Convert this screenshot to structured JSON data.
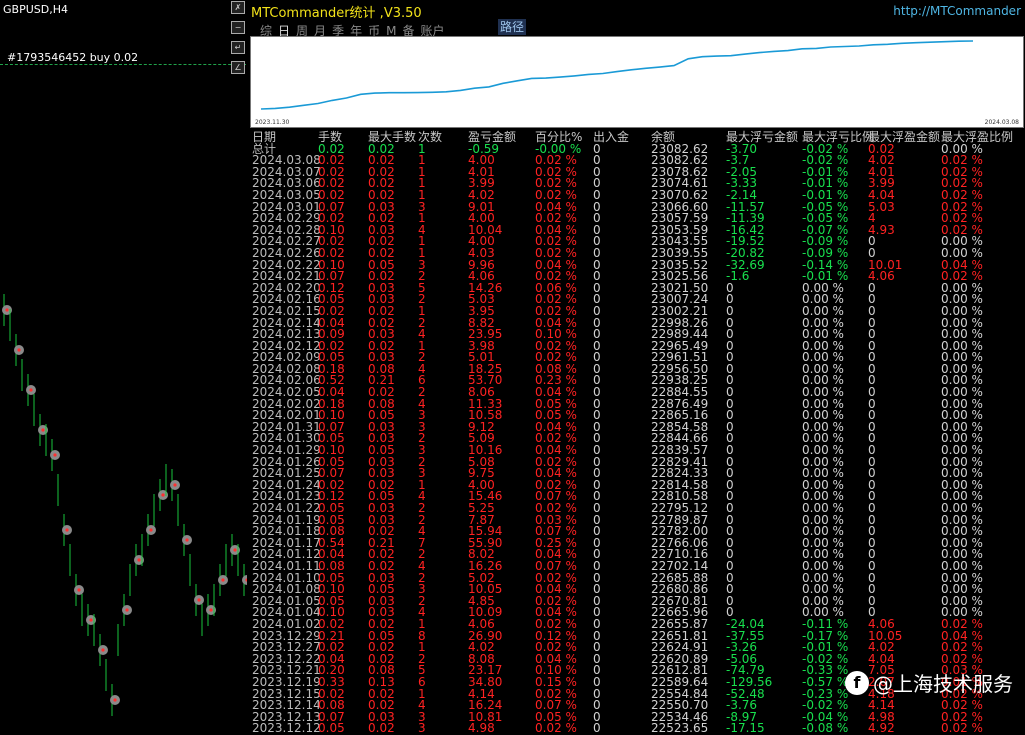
{
  "chart": {
    "title": "GBPUSD,H4",
    "order_label": "#1793546452 buy 0.02",
    "buttons": [
      "✗",
      "−",
      "↵",
      "∠"
    ]
  },
  "panel": {
    "title": "MTCommander统计 ,V3.50",
    "url": "http://MTCommander",
    "tabs": [
      "综",
      "日",
      "周",
      "月",
      "季",
      "年",
      "币",
      "M",
      "备",
      "账户"
    ],
    "active_tab_index": 1,
    "route_button": "路径",
    "equity": {
      "start_label": "2023.11.30",
      "end_label": "2024.03.08",
      "line_color": "#1a9ad6",
      "values": [
        22530,
        22535,
        22545,
        22560,
        22575,
        22600,
        22620,
        22650,
        22660,
        22663,
        22663,
        22664,
        22666,
        22670,
        22682,
        22700,
        22710,
        22740,
        22760,
        22780,
        22782,
        22790,
        22800,
        22812,
        22820,
        22835,
        22850,
        22862,
        22872,
        22884,
        22940,
        22957,
        22962,
        22965,
        22978,
        22990,
        23000,
        23007,
        23021,
        23025,
        23036,
        23040,
        23044,
        23054,
        23058,
        23066,
        23071,
        23075,
        23079,
        23083,
        23085
      ]
    }
  },
  "table": {
    "headers": [
      "日期",
      "手数",
      "最大手数",
      "次数",
      "盈亏金额",
      "百分比%",
      "出入金",
      "余额",
      "最大浮亏金额",
      "最大浮亏比例",
      "最大浮盈金额",
      "最大浮盈比例"
    ],
    "rows": [
      [
        "总计",
        "0.02",
        "0.02",
        "1",
        "-0.59",
        "-0.00 %",
        "0",
        "23082.62",
        "-3.70",
        "-0.02 %",
        "0.02",
        "0.00 %"
      ],
      [
        "2024.03.08",
        "0.02",
        "0.02",
        "1",
        "4.00",
        "0.02 %",
        "0",
        "23082.62",
        "-3.7",
        "-0.02 %",
        "4.02",
        "0.02 %"
      ],
      [
        "2024.03.07",
        "0.02",
        "0.02",
        "1",
        "4.01",
        "0.02 %",
        "0",
        "23078.62",
        "-2.05",
        "-0.01 %",
        "4.01",
        "0.02 %"
      ],
      [
        "2024.03.06",
        "0.02",
        "0.02",
        "1",
        "3.99",
        "0.02 %",
        "0",
        "23074.61",
        "-3.33",
        "-0.01 %",
        "3.99",
        "0.02 %"
      ],
      [
        "2024.03.05",
        "0.02",
        "0.02",
        "1",
        "4.02",
        "0.02 %",
        "0",
        "23070.62",
        "-2.14",
        "-0.01 %",
        "4.04",
        "0.02 %"
      ],
      [
        "2024.03.01",
        "0.07",
        "0.03",
        "3",
        "9.01",
        "0.04 %",
        "0",
        "23066.60",
        "-11.57",
        "-0.05 %",
        "5.03",
        "0.02 %"
      ],
      [
        "2024.02.29",
        "0.02",
        "0.02",
        "1",
        "4.00",
        "0.02 %",
        "0",
        "23057.59",
        "-11.39",
        "-0.05 %",
        "4",
        "0.02 %"
      ],
      [
        "2024.02.28",
        "0.10",
        "0.03",
        "4",
        "10.04",
        "0.04 %",
        "0",
        "23053.59",
        "-16.42",
        "-0.07 %",
        "4.93",
        "0.02 %"
      ],
      [
        "2024.02.27",
        "0.02",
        "0.02",
        "1",
        "4.00",
        "0.02 %",
        "0",
        "23043.55",
        "-19.52",
        "-0.09 %",
        "0",
        "0.00 %"
      ],
      [
        "2024.02.26",
        "0.02",
        "0.02",
        "1",
        "4.03",
        "0.02 %",
        "0",
        "23039.55",
        "-20.82",
        "-0.09 %",
        "0",
        "0.00 %"
      ],
      [
        "2024.02.22",
        "0.10",
        "0.05",
        "3",
        "9.96",
        "0.04 %",
        "0",
        "23035.52",
        "-32.69",
        "-0.14 %",
        "10.01",
        "0.04 %"
      ],
      [
        "2024.02.21",
        "0.07",
        "0.02",
        "2",
        "4.06",
        "0.02 %",
        "0",
        "23025.56",
        "-1.6",
        "-0.01 %",
        "4.06",
        "0.02 %"
      ],
      [
        "2024.02.20",
        "0.12",
        "0.03",
        "5",
        "14.26",
        "0.06 %",
        "0",
        "23021.50",
        "0",
        "0.00 %",
        "0",
        "0.00 %"
      ],
      [
        "2024.02.16",
        "0.05",
        "0.03",
        "2",
        "5.03",
        "0.02 %",
        "0",
        "23007.24",
        "0",
        "0.00 %",
        "0",
        "0.00 %"
      ],
      [
        "2024.02.15",
        "0.02",
        "0.02",
        "1",
        "3.95",
        "0.02 %",
        "0",
        "23002.21",
        "0",
        "0.00 %",
        "0",
        "0.00 %"
      ],
      [
        "2024.02.14",
        "0.04",
        "0.02",
        "2",
        "8.82",
        "0.04 %",
        "0",
        "22998.26",
        "0",
        "0.00 %",
        "0",
        "0.00 %"
      ],
      [
        "2024.02.13",
        "0.09",
        "0.03",
        "4",
        "23.95",
        "0.10 %",
        "0",
        "22989.44",
        "0",
        "0.00 %",
        "0",
        "0.00 %"
      ],
      [
        "2024.02.12",
        "0.02",
        "0.02",
        "1",
        "3.98",
        "0.02 %",
        "0",
        "22965.49",
        "0",
        "0.00 %",
        "0",
        "0.00 %"
      ],
      [
        "2024.02.09",
        "0.05",
        "0.03",
        "2",
        "5.01",
        "0.02 %",
        "0",
        "22961.51",
        "0",
        "0.00 %",
        "0",
        "0.00 %"
      ],
      [
        "2024.02.08",
        "0.18",
        "0.08",
        "4",
        "18.25",
        "0.08 %",
        "0",
        "22956.50",
        "0",
        "0.00 %",
        "0",
        "0.00 %"
      ],
      [
        "2024.02.06",
        "0.52",
        "0.21",
        "6",
        "53.70",
        "0.23 %",
        "0",
        "22938.25",
        "0",
        "0.00 %",
        "0",
        "0.00 %"
      ],
      [
        "2024.02.05",
        "0.04",
        "0.02",
        "2",
        "8.06",
        "0.04 %",
        "0",
        "22884.55",
        "0",
        "0.00 %",
        "0",
        "0.00 %"
      ],
      [
        "2024.02.02",
        "0.18",
        "0.08",
        "4",
        "11.33",
        "0.05 %",
        "0",
        "22876.49",
        "0",
        "0.00 %",
        "0",
        "0.00 %"
      ],
      [
        "2024.02.01",
        "0.10",
        "0.05",
        "3",
        "10.58",
        "0.05 %",
        "0",
        "22865.16",
        "0",
        "0.00 %",
        "0",
        "0.00 %"
      ],
      [
        "2024.01.31",
        "0.07",
        "0.03",
        "3",
        "9.12",
        "0.04 %",
        "0",
        "22854.58",
        "0",
        "0.00 %",
        "0",
        "0.00 %"
      ],
      [
        "2024.01.30",
        "0.05",
        "0.03",
        "2",
        "5.09",
        "0.02 %",
        "0",
        "22844.66",
        "0",
        "0.00 %",
        "0",
        "0.00 %"
      ],
      [
        "2024.01.29",
        "0.10",
        "0.05",
        "3",
        "10.16",
        "0.04 %",
        "0",
        "22839.57",
        "0",
        "0.00 %",
        "0",
        "0.00 %"
      ],
      [
        "2024.01.26",
        "0.05",
        "0.03",
        "2",
        "5.08",
        "0.02 %",
        "0",
        "22829.41",
        "0",
        "0.00 %",
        "0",
        "0.00 %"
      ],
      [
        "2024.01.25",
        "0.07",
        "0.03",
        "3",
        "9.75",
        "0.04 %",
        "0",
        "22824.33",
        "0",
        "0.00 %",
        "0",
        "0.00 %"
      ],
      [
        "2024.01.24",
        "0.02",
        "0.02",
        "1",
        "4.00",
        "0.02 %",
        "0",
        "22814.58",
        "0",
        "0.00 %",
        "0",
        "0.00 %"
      ],
      [
        "2024.01.23",
        "0.12",
        "0.05",
        "4",
        "15.46",
        "0.07 %",
        "0",
        "22810.58",
        "0",
        "0.00 %",
        "0",
        "0.00 %"
      ],
      [
        "2024.01.22",
        "0.05",
        "0.03",
        "2",
        "5.25",
        "0.02 %",
        "0",
        "22795.12",
        "0",
        "0.00 %",
        "0",
        "0.00 %"
      ],
      [
        "2024.01.19",
        "0.05",
        "0.03",
        "2",
        "7.87",
        "0.03 %",
        "0",
        "22789.87",
        "0",
        "0.00 %",
        "0",
        "0.00 %"
      ],
      [
        "2024.01.18",
        "0.08",
        "0.02",
        "4",
        "15.94",
        "0.07 %",
        "0",
        "22782.00",
        "0",
        "0.00 %",
        "0",
        "0.00 %"
      ],
      [
        "2024.01.17",
        "0.54",
        "0.21",
        "7",
        "55.90",
        "0.25 %",
        "0",
        "22766.06",
        "0",
        "0.00 %",
        "0",
        "0.00 %"
      ],
      [
        "2024.01.12",
        "0.04",
        "0.02",
        "2",
        "8.02",
        "0.04 %",
        "0",
        "22710.16",
        "0",
        "0.00 %",
        "0",
        "0.00 %"
      ],
      [
        "2024.01.11",
        "0.08",
        "0.02",
        "4",
        "16.26",
        "0.07 %",
        "0",
        "22702.14",
        "0",
        "0.00 %",
        "0",
        "0.00 %"
      ],
      [
        "2024.01.10",
        "0.05",
        "0.03",
        "2",
        "5.02",
        "0.02 %",
        "0",
        "22685.88",
        "0",
        "0.00 %",
        "0",
        "0.00 %"
      ],
      [
        "2024.01.08",
        "0.10",
        "0.05",
        "3",
        "10.05",
        "0.04 %",
        "0",
        "22680.86",
        "0",
        "0.00 %",
        "0",
        "0.00 %"
      ],
      [
        "2024.01.05",
        "0.05",
        "0.03",
        "2",
        "4.85",
        "0.02 %",
        "0",
        "22670.81",
        "0",
        "0.00 %",
        "0",
        "0.00 %"
      ],
      [
        "2024.01.04",
        "0.10",
        "0.03",
        "4",
        "10.09",
        "0.04 %",
        "0",
        "22665.96",
        "0",
        "0.00 %",
        "0",
        "0.00 %"
      ],
      [
        "2024.01.02",
        "0.02",
        "0.02",
        "1",
        "4.06",
        "0.02 %",
        "0",
        "22655.87",
        "-24.04",
        "-0.11 %",
        "4.06",
        "0.02 %"
      ],
      [
        "2023.12.29",
        "0.21",
        "0.05",
        "8",
        "26.90",
        "0.12 %",
        "0",
        "22651.81",
        "-37.55",
        "-0.17 %",
        "10.05",
        "0.04 %"
      ],
      [
        "2023.12.27",
        "0.02",
        "0.02",
        "1",
        "4.02",
        "0.02 %",
        "0",
        "22624.91",
        "-3.26",
        "-0.01 %",
        "4.02",
        "0.02 %"
      ],
      [
        "2023.12.22",
        "0.04",
        "0.02",
        "2",
        "8.08",
        "0.04 %",
        "0",
        "22620.89",
        "-5.06",
        "-0.02 %",
        "4.04",
        "0.02 %"
      ],
      [
        "2023.12.21",
        "0.20",
        "0.08",
        "5",
        "23.17",
        "0.10 %",
        "0",
        "22612.81",
        "-74.79",
        "-0.33 %",
        "7.05",
        "0.03 %"
      ],
      [
        "2023.12.19",
        "0.33",
        "0.13",
        "6",
        "34.80",
        "0.15 %",
        "0",
        "22589.64",
        "-129.56",
        "-0.57 %",
        "2.07",
        "0.01 %"
      ],
      [
        "2023.12.15",
        "0.02",
        "0.02",
        "1",
        "4.14",
        "0.02 %",
        "0",
        "22554.84",
        "-52.48",
        "-0.23 %",
        "4.18",
        "0.02 %"
      ],
      [
        "2023.12.14",
        "0.08",
        "0.02",
        "4",
        "16.24",
        "0.07 %",
        "0",
        "22550.70",
        "-3.76",
        "-0.02 %",
        "4.14",
        "0.02 %"
      ],
      [
        "2023.12.13",
        "0.07",
        "0.03",
        "3",
        "10.81",
        "0.05 %",
        "0",
        "22534.46",
        "-8.97",
        "-0.04 %",
        "4.98",
        "0.02 %"
      ],
      [
        "2023.12.12",
        "0.05",
        "0.02",
        "3",
        "4.98",
        "0.02 %",
        "0",
        "22523.65",
        "-17.15",
        "-0.08 %",
        "4.92",
        "0.02 %"
      ]
    ]
  },
  "watermark": {
    "icon_text": "f",
    "text": "@上海技术服务"
  },
  "colors": {
    "positive": "#18e04e",
    "negative": "#ff2222",
    "neutral": "#d2d2d2",
    "title": "#f2e21a",
    "url": "#4fb6e4"
  }
}
